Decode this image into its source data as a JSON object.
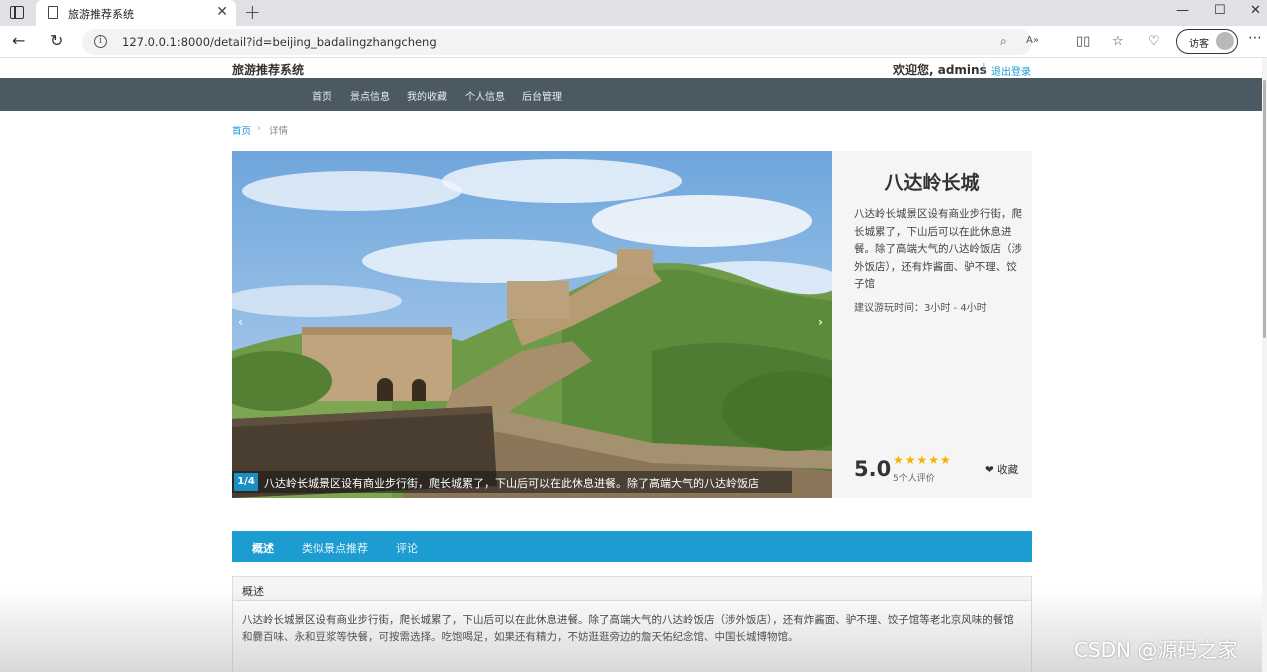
{
  "browser": {
    "tab_title": "旅游推荐系统",
    "tab_close": "✕",
    "new_tab": "+",
    "url": "127.0.0.1:8000/detail?id=beijing_badalingzhangcheng",
    "guest_label": "访客",
    "window_controls": {
      "minimize": "—",
      "maximize": "☐",
      "close": "✕"
    }
  },
  "header": {
    "site_name": "旅游推荐系统",
    "welcome": "欢迎您, admins",
    "separator": "|",
    "logout": "退出登录"
  },
  "nav": {
    "items": [
      "首页",
      "景点信息",
      "我的收藏",
      "个人信息",
      "后台管理"
    ]
  },
  "breadcrumb": {
    "home": "首页",
    "separator": "›",
    "current": "详情"
  },
  "carousel": {
    "slide_number": "1/4",
    "caption": "八达岭长城景区设有商业步行街，爬长城累了，下山后可以在此休息进餐。除了高端大气的八达岭饭店",
    "prev": "‹",
    "next": "›"
  },
  "attraction": {
    "title": "八达岭长城",
    "description": "八达岭长城景区设有商业步行街，爬长城累了，下山后可以在此休息进餐。除了高端大气的八达岭饭店（涉外饭店），还有炸酱面、驴不理、饺子馆",
    "suggested_time": "建议游玩时间：3小时 - 4小时",
    "score": "5.0",
    "stars": "★★★★★",
    "rating_count": "5个人评价",
    "favorite_label": "❤ 收藏"
  },
  "tabs": [
    "概述",
    "类似景点推荐",
    "评论"
  ],
  "overview": {
    "title": "概述",
    "body": "八达岭长城景区设有商业步行街，爬长城累了，下山后可以在此休息进餐。除了高端大气的八达岭饭店（涉外饭店），还有炸酱面、驴不理、饺子馆等老北京风味的餐馆和爨百味、永和豆浆等快餐，可按需选择。吃饱喝足，如果还有精力，不妨逛逛旁边的詹天佑纪念馆、中国长城博物馆。"
  },
  "watermark": "CSDN @源码之家",
  "colors": {
    "navbar": "#4b5963",
    "accent": "#1c9cd1",
    "star": "#f0b400"
  }
}
